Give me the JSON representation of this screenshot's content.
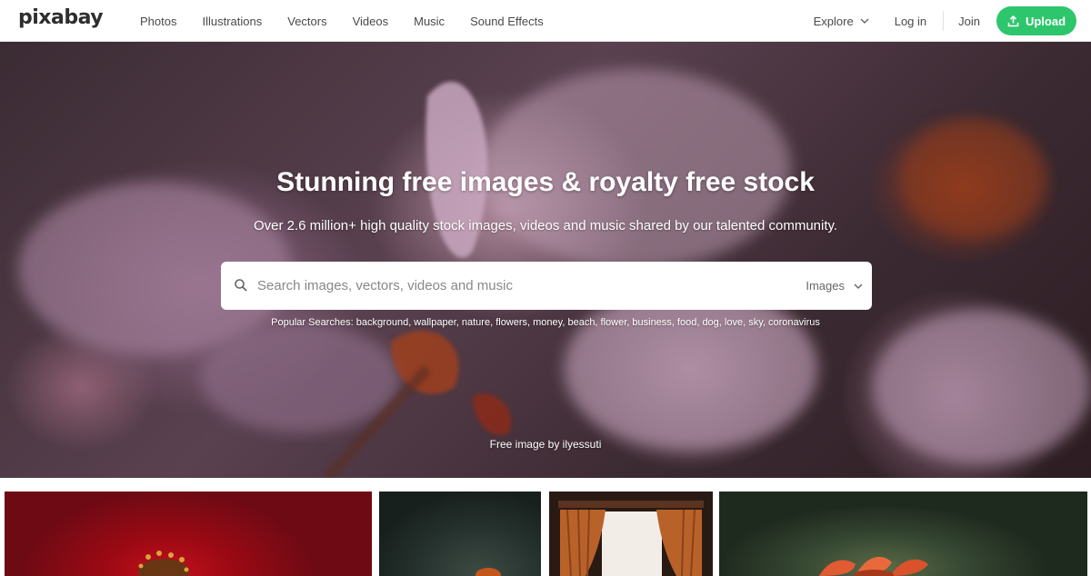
{
  "header": {
    "logo": "pixabay",
    "nav": [
      "Photos",
      "Illustrations",
      "Vectors",
      "Videos",
      "Music",
      "Sound Effects"
    ],
    "explore_label": "Explore",
    "login_label": "Log in",
    "join_label": "Join",
    "upload_label": "Upload",
    "upload_color": "#2ec66d"
  },
  "hero": {
    "title": "Stunning free images & royalty free stock",
    "subtitle": "Over 2.6 million+ high quality stock images, videos and music shared by our talented community.",
    "search_placeholder": "Search images, vectors, videos and music",
    "search_type": "Images",
    "popular_label": "Popular Searches:",
    "popular_terms": "background, wallpaper, nature, flowers, money, beach, flower, business, food, dog, love, sky, coronavirus",
    "credit": "Free image by ilyessuti"
  }
}
